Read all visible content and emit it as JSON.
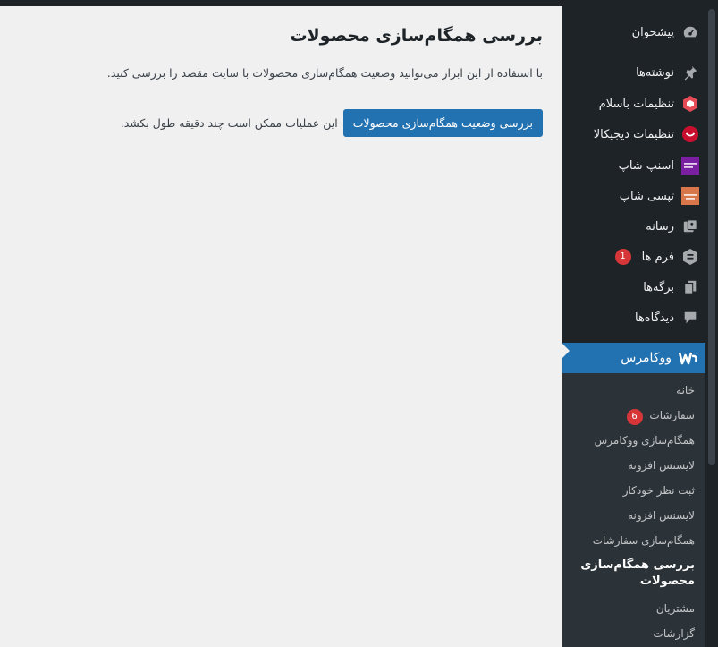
{
  "menu": {
    "items": [
      {
        "label": "پیشخوان",
        "icon": "dashboard-icon"
      },
      {
        "label": "نوشته‌ها",
        "icon": "pin-icon"
      },
      {
        "label": "تنظیمات باسلام",
        "icon": "basalam-icon"
      },
      {
        "label": "تنظیمات دیجیکالا",
        "icon": "digikala-icon"
      },
      {
        "label": "اسنپ شاپ",
        "icon": "snappshop-icon"
      },
      {
        "label": "تپسی شاپ",
        "icon": "tapsishop-icon"
      },
      {
        "label": "رسانه",
        "icon": "media-icon"
      },
      {
        "label": "فرم ها",
        "icon": "forms-icon",
        "badge": "1"
      },
      {
        "label": "برگه‌ها",
        "icon": "pages-icon"
      },
      {
        "label": "دیدگاه‌ها",
        "icon": "comments-icon"
      }
    ],
    "woocommerce": {
      "label": "ووکامرس",
      "icon": "woocommerce-icon"
    },
    "submenu": [
      {
        "label": "خانه"
      },
      {
        "label": "سفارشات",
        "badge": "6"
      },
      {
        "label": "همگام‌سازی ووکامرس"
      },
      {
        "label": "لایسنس افزونه"
      },
      {
        "label": "ثبت نظر خودکار"
      },
      {
        "label": "لایسنس افزونه"
      },
      {
        "label": "همگام‌سازی سفارشات"
      },
      {
        "label": "بررسی همگام‌سازی محصولات",
        "current": true
      },
      {
        "label": "مشتریان"
      },
      {
        "label": "گزارشات"
      }
    ]
  },
  "main": {
    "title": "بررسی همگام‌سازی محصولات",
    "description": "با استفاده از این ابزار می‌توانید وضعیت همگام‌سازی محصولات با سایت مقصد را بررسی کنید.",
    "check_button": "بررسی وضعیت همگام‌سازی محصولات",
    "note": "این عملیات ممکن است چند دقیقه طول بکشد."
  },
  "colors": {
    "sidebar_bg": "#1d2327",
    "submenu_bg": "#2c3338",
    "accent": "#2271b1",
    "badge": "#d63638",
    "page_bg": "#f0f0f1"
  }
}
